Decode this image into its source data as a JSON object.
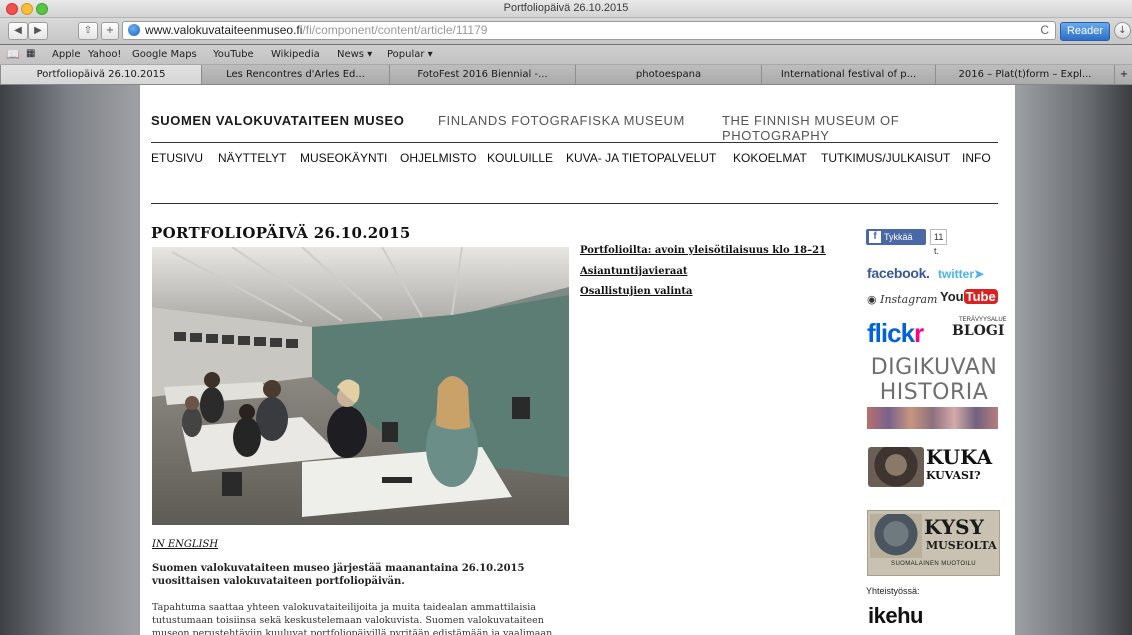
{
  "window": {
    "title": "Portfoliopäivä 26.10.2015"
  },
  "toolbar": {
    "back_icon": "◀",
    "forward_icon": "▶",
    "share_icon": "⇧",
    "add_icon": "+",
    "url_domain": "www.valokuvataiteenmuseo.fi",
    "url_path": "/fi/component/content/article/11179",
    "reload_icon": "C",
    "reader_label": "Reader",
    "download_icon": "↓"
  },
  "bookmarks": [
    {
      "label": "Apple"
    },
    {
      "label": "Yahoo!"
    },
    {
      "label": "Google Maps"
    },
    {
      "label": "YouTube"
    },
    {
      "label": "Wikipedia"
    },
    {
      "label": "News ▾"
    },
    {
      "label": "Popular ▾"
    }
  ],
  "tabs": [
    {
      "label": "Portfoliopäivä 26.10.2015",
      "active": true
    },
    {
      "label": "Les Rencontres d'Arles Ed...",
      "active": false
    },
    {
      "label": "FotoFest 2016 Biennial -...",
      "active": false
    },
    {
      "label": "photoespana",
      "active": false
    },
    {
      "label": "International festival of p...",
      "active": false
    },
    {
      "label": "2016 – Plat(t)form – Expl...",
      "active": false
    }
  ],
  "tab_add_icon": "+",
  "site": {
    "name_fi": "SUOMEN VALOKUVATAITEEN MUSEO",
    "name_se": "FINLANDS FOTOGRAFISKA MUSEUM",
    "name_en": "THE FINNISH MUSEUM OF PHOTOGRAPHY"
  },
  "nav": [
    "ETUSIVU",
    "NÄYTTELYT",
    "MUSEOKÄYNTI",
    "OHJELMISTO",
    "KOULUILLE",
    "KUVA- JA TIETOPALVELUT",
    "KOKOELMAT",
    "TUTKIMUS/JULKAISUT",
    "INFO"
  ],
  "article": {
    "title": "PORTFOLIOPÄIVÄ 26.10.2015",
    "toc": [
      "Portfolioilta: avoin yleisötilaisuus klo 18–21",
      "Asiantuntijavieraat",
      "Osallistujien valinta"
    ],
    "in_english": "IN ENGLISH",
    "lead_1": "Suomen valokuvataiteen museo järjestää maanantaina 26.10.2015",
    "lead_2": "vuosittaisen valokuvataiteen portfoliopäivän.",
    "body_1": "Tapahtuma saattaa yhteen valokuvataiteilijoita ja muita taidealan ammattilaisia",
    "body_2": "tutustumaan toisiinsa sekä keskustelemaan valokuvista. Suomen valokuvataiteen",
    "body_3": "museon perustehtäviin kuuluvat portfoliopäivillä pyritään edistämään ja vaalimaan"
  },
  "sidebar": {
    "like_label": "Tykkää",
    "like_count": "11 t.",
    "facebook": "facebook.",
    "twitter": "twitter",
    "instagram": "Instagram",
    "youtube_you": "You",
    "youtube_tube": "Tube",
    "flickr_fl": "flick",
    "flickr_r": "r",
    "flickr_blogi": "BLOGI",
    "flickr_sub": "TERÄVYYSALUE",
    "digikuvan_1": "DIGIKUVAN",
    "digikuvan_2": "HISTORIA",
    "kuka": "KUKA",
    "kuka_sub": "KUVASI?",
    "kysy": "KYSY",
    "kysy_sub": "MUSEOLTA",
    "kysy_foot": "SUOMALAINEN MUOTOILU",
    "partners_label": "Yhteistyössä:",
    "ikehu": "ikehu"
  }
}
